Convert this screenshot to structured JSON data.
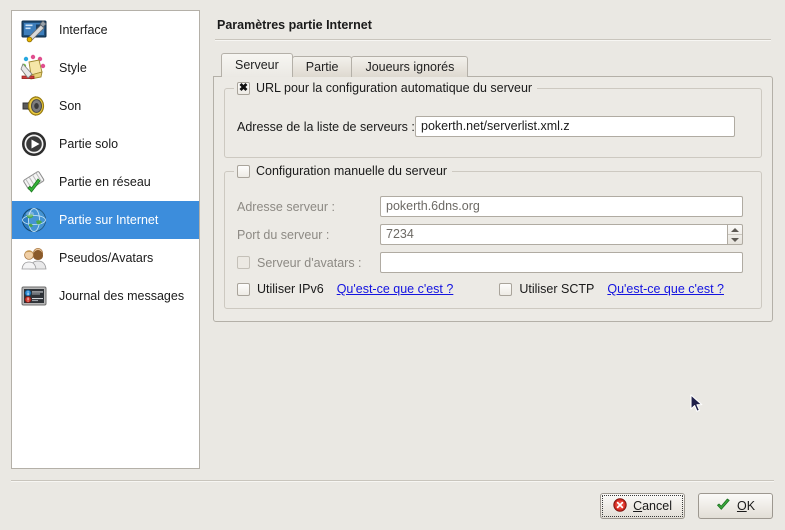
{
  "sidebar": {
    "items": [
      {
        "label": "Interface",
        "icon": "interface-icon",
        "selected": false
      },
      {
        "label": "Style",
        "icon": "style-icon",
        "selected": false
      },
      {
        "label": "Son",
        "icon": "sound-icon",
        "selected": false
      },
      {
        "label": "Partie solo",
        "icon": "play-icon",
        "selected": false
      },
      {
        "label": "Partie en réseau",
        "icon": "network-icon",
        "selected": false
      },
      {
        "label": "Partie sur Internet",
        "icon": "globe-icon",
        "selected": true
      },
      {
        "label": "Pseudos/Avatars",
        "icon": "users-icon",
        "selected": false
      },
      {
        "label": "Journal des messages",
        "icon": "log-icon",
        "selected": false
      }
    ]
  },
  "main": {
    "page_title": "Paramètres partie Internet",
    "tabs": [
      {
        "label": "Serveur",
        "active": true
      },
      {
        "label": "Partie",
        "active": false
      },
      {
        "label": "Joueurs ignorés",
        "active": false
      }
    ],
    "auto_group": {
      "title": "URL pour la configuration automatique du serveur",
      "checked": true,
      "serverlist_label": "Adresse de la liste de serveurs :",
      "serverlist_value": "pokerth.net/serverlist.xml.z",
      "serverlist_placeholder": ""
    },
    "manual_group": {
      "title": "Configuration manuelle du serveur",
      "checked": false,
      "server_address_label": "Adresse serveur :",
      "server_address_value": "pokerth.6dns.org",
      "server_port_label": "Port du serveur :",
      "server_port_value": "7234",
      "avatar_server_label": "Serveur d'avatars :",
      "avatar_server_checked": false,
      "avatar_server_value": "",
      "ipv6_label": "Utiliser IPv6",
      "ipv6_checked": false,
      "ipv6_help": "Qu'est-ce que c'est ?",
      "sctp_label": "Utiliser SCTP",
      "sctp_checked": false,
      "sctp_help": "Qu'est-ce que c'est ?"
    }
  },
  "footer": {
    "cancel_label": "Cancel",
    "cancel_icon": "error-x-icon",
    "ok_label": "OK",
    "ok_icon": "check-icon"
  },
  "colors": {
    "selection": "#3c8ddc",
    "window_bg": "#eae8e3",
    "link": "#1414e0"
  }
}
